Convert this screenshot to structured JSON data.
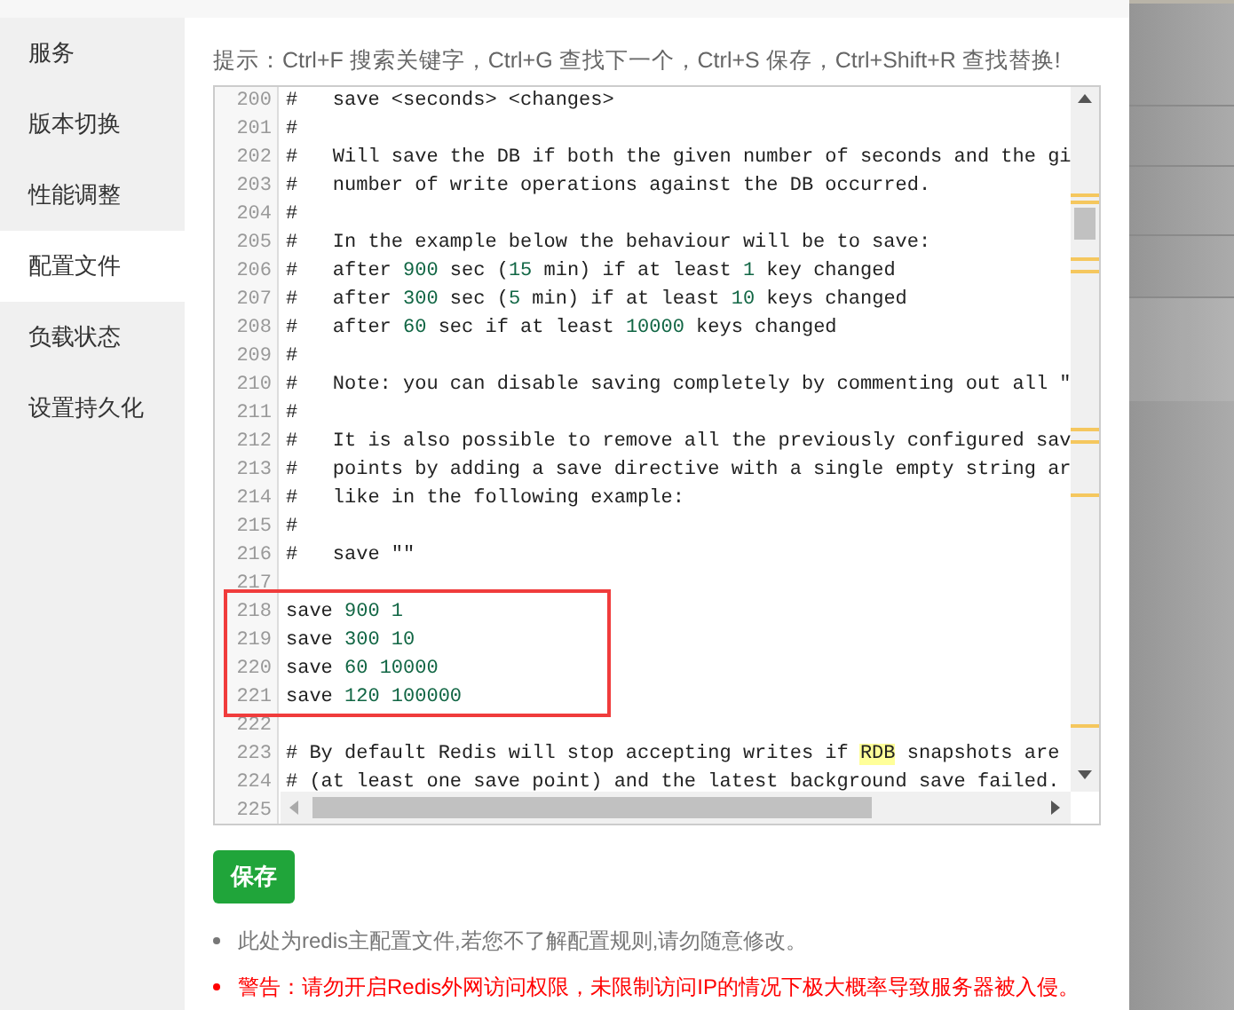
{
  "sidebar": {
    "items": [
      {
        "label": "服务",
        "selected": false
      },
      {
        "label": "版本切换",
        "selected": false
      },
      {
        "label": "性能调整",
        "selected": false
      },
      {
        "label": "配置文件",
        "selected": true
      },
      {
        "label": "负载状态",
        "selected": false
      },
      {
        "label": "设置持久化",
        "selected": false
      }
    ]
  },
  "hint": "提示：Ctrl+F 搜索关键字，Ctrl+G 查找下一个，Ctrl+S 保存，Ctrl+Shift+R 查找替换!",
  "editor": {
    "lines": [
      {
        "number": "200",
        "boxed": false,
        "segments": [
          {
            "kind": "text",
            "text": "#   save <seconds> <changes>"
          }
        ]
      },
      {
        "number": "201",
        "boxed": false,
        "segments": [
          {
            "kind": "text",
            "text": "#"
          }
        ]
      },
      {
        "number": "202",
        "boxed": false,
        "segments": [
          {
            "kind": "text",
            "text": "#   Will save the DB if both the given number of seconds and the gi"
          }
        ]
      },
      {
        "number": "203",
        "boxed": false,
        "segments": [
          {
            "kind": "text",
            "text": "#   number of write operations against the DB occurred."
          }
        ]
      },
      {
        "number": "204",
        "boxed": false,
        "segments": [
          {
            "kind": "text",
            "text": "#"
          }
        ]
      },
      {
        "number": "205",
        "boxed": false,
        "segments": [
          {
            "kind": "text",
            "text": "#   In the example below the behaviour will be to save:"
          }
        ]
      },
      {
        "number": "206",
        "boxed": false,
        "segments": [
          {
            "kind": "text",
            "text": "#   after "
          },
          {
            "kind": "number",
            "text": "900"
          },
          {
            "kind": "text",
            "text": " sec ("
          },
          {
            "kind": "number",
            "text": "15"
          },
          {
            "kind": "text",
            "text": " min) if at least "
          },
          {
            "kind": "number",
            "text": "1"
          },
          {
            "kind": "text",
            "text": " key changed"
          }
        ]
      },
      {
        "number": "207",
        "boxed": false,
        "segments": [
          {
            "kind": "text",
            "text": "#   after "
          },
          {
            "kind": "number",
            "text": "300"
          },
          {
            "kind": "text",
            "text": " sec ("
          },
          {
            "kind": "number",
            "text": "5"
          },
          {
            "kind": "text",
            "text": " min) if at least "
          },
          {
            "kind": "number",
            "text": "10"
          },
          {
            "kind": "text",
            "text": " keys changed"
          }
        ]
      },
      {
        "number": "208",
        "boxed": false,
        "segments": [
          {
            "kind": "text",
            "text": "#   after "
          },
          {
            "kind": "number",
            "text": "60"
          },
          {
            "kind": "text",
            "text": " sec if at least "
          },
          {
            "kind": "number",
            "text": "10000"
          },
          {
            "kind": "text",
            "text": " keys changed"
          }
        ]
      },
      {
        "number": "209",
        "boxed": false,
        "segments": [
          {
            "kind": "text",
            "text": "#"
          }
        ]
      },
      {
        "number": "210",
        "boxed": false,
        "segments": [
          {
            "kind": "text",
            "text": "#   Note: you can disable saving completely by commenting out all \""
          }
        ]
      },
      {
        "number": "211",
        "boxed": false,
        "segments": [
          {
            "kind": "text",
            "text": "#"
          }
        ]
      },
      {
        "number": "212",
        "boxed": false,
        "segments": [
          {
            "kind": "text",
            "text": "#   It is also possible to remove all the previously configured sav"
          }
        ]
      },
      {
        "number": "213",
        "boxed": false,
        "segments": [
          {
            "kind": "text",
            "text": "#   points by adding a save directive with a single empty string ar"
          }
        ]
      },
      {
        "number": "214",
        "boxed": false,
        "segments": [
          {
            "kind": "text",
            "text": "#   like in the following example:"
          }
        ]
      },
      {
        "number": "215",
        "boxed": false,
        "segments": [
          {
            "kind": "text",
            "text": "#"
          }
        ]
      },
      {
        "number": "216",
        "boxed": false,
        "segments": [
          {
            "kind": "text",
            "text": "#   save \"\""
          }
        ]
      },
      {
        "number": "217",
        "boxed": false
      },
      {
        "number": "218",
        "boxed": true,
        "segments": [
          {
            "kind": "text",
            "text": "save "
          },
          {
            "kind": "number",
            "text": "900 1"
          }
        ]
      },
      {
        "number": "219",
        "boxed": true,
        "segments": [
          {
            "kind": "text",
            "text": "save "
          },
          {
            "kind": "number",
            "text": "300 10"
          }
        ]
      },
      {
        "number": "220",
        "boxed": true,
        "segments": [
          {
            "kind": "text",
            "text": "save "
          },
          {
            "kind": "number",
            "text": "60 10000"
          }
        ]
      },
      {
        "number": "221",
        "boxed": true,
        "segments": [
          {
            "kind": "text",
            "text": "save "
          },
          {
            "kind": "number",
            "text": "120 100000"
          }
        ]
      },
      {
        "number": "222",
        "boxed": false
      },
      {
        "number": "223",
        "boxed": false,
        "segments": [
          {
            "kind": "text",
            "text": "# By default Redis will stop accepting writes if "
          },
          {
            "kind": "match",
            "text": "RDB"
          },
          {
            "kind": "text",
            "text": " snapshots are"
          }
        ]
      },
      {
        "number": "224",
        "boxed": false,
        "segments": [
          {
            "kind": "text",
            "text": "# (at least one save point) and the latest background save failed."
          }
        ]
      },
      {
        "number": "225",
        "boxed": false
      }
    ]
  },
  "save_button": "保存",
  "notes": [
    {
      "kind": "info",
      "text": "此处为redis主配置文件,若您不了解配置规则,请勿随意修改。"
    },
    {
      "kind": "warning",
      "text": "警告：请勿开启Redis外网访问权限，未限制访问IP的情况下极大概率导致服务器被入侵。"
    }
  ]
}
